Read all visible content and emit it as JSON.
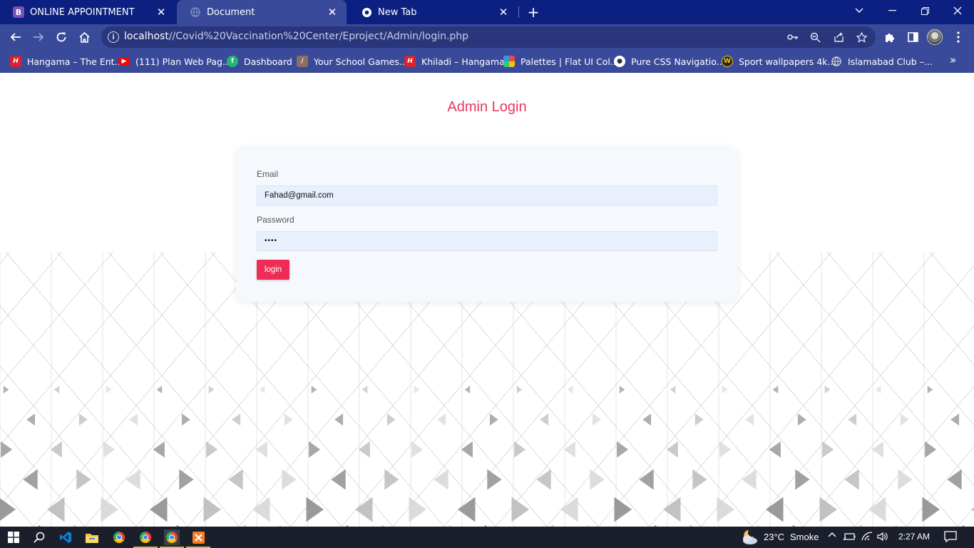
{
  "browser": {
    "tabs": [
      {
        "title": "ONLINE APPOINTMENT",
        "icon": "bootstrap-icon",
        "icon_text": "B",
        "active": false
      },
      {
        "title": "Document",
        "icon": "globe-icon",
        "active": true
      },
      {
        "title": "New Tab",
        "icon": "chrome-icon",
        "active": false
      }
    ],
    "close_glyph": "✕",
    "new_tab_glyph": "+",
    "url_host": "localhost",
    "url_path": "//Covid%20Vaccination%20Center/Eproject/Admin/login.php"
  },
  "bookmarks": [
    {
      "label": "Hangama – The Ent...",
      "icon": "hangama-icon",
      "color": "#d6222e"
    },
    {
      "label": "(111) Plan Web Pag...",
      "icon": "youtube-icon",
      "color": "#ff0000"
    },
    {
      "label": "Dashboard",
      "icon": "dashboard-icon",
      "color": "#22b573"
    },
    {
      "label": "Your School Games...",
      "icon": "school-games-icon",
      "color": "#8d6e63"
    },
    {
      "label": "Khiladi – Hangama",
      "icon": "hangama-icon",
      "color": "#d6222e"
    },
    {
      "label": "Palettes | Flat UI Col...",
      "icon": "palettes-icon",
      "color": "#f1c40f"
    },
    {
      "label": "Pure CSS Navigatio...",
      "icon": "css-nav-icon",
      "color": "#ffffff"
    },
    {
      "label": "Sport wallpapers 4k...",
      "icon": "wallpapers-icon",
      "color": "#f5c518"
    },
    {
      "label": "Islamabad Club –...",
      "icon": "globe-icon",
      "color": "#cccccc"
    }
  ],
  "page": {
    "title": "Admin Login",
    "email_label": "Email",
    "email_value": "Fahad@gmail.com",
    "password_label": "Password",
    "password_value": "••••",
    "login_label": "login"
  },
  "colors": {
    "accent": "#ee2c55",
    "title": "#e8375a",
    "tabstrip": "#0b2080",
    "toolbar": "#3a4a9a"
  },
  "taskbar": {
    "temperature": "23°C",
    "weather": "Smoke",
    "time": "2:27 AM"
  }
}
